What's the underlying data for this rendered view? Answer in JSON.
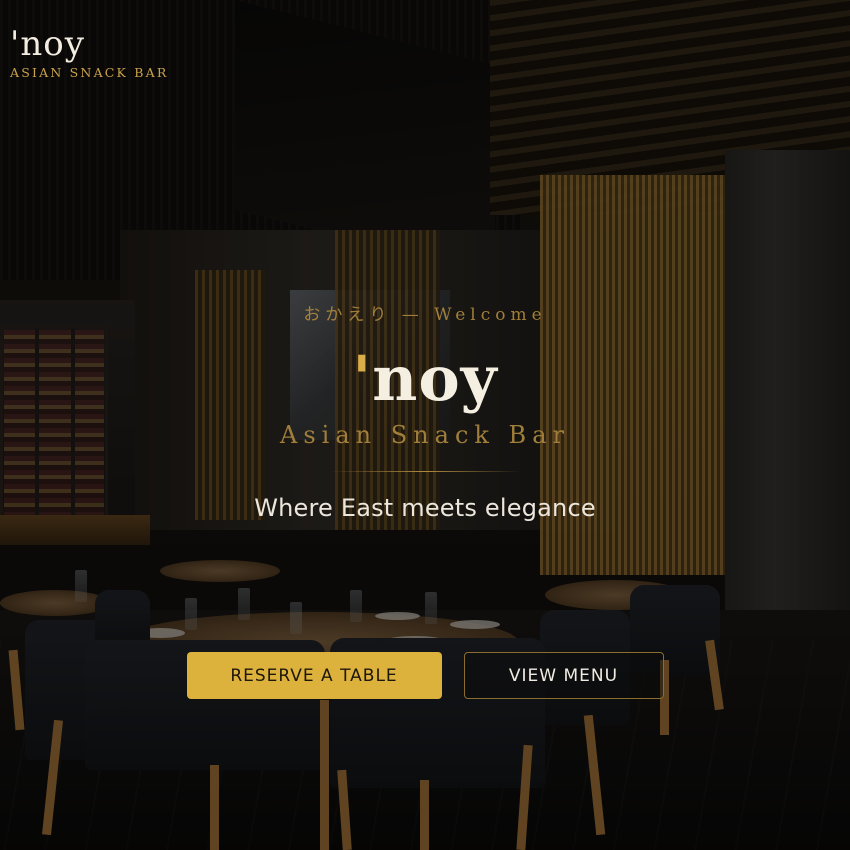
{
  "brand": {
    "name": "'noy",
    "tagline": "ASIAN SNACK BAR"
  },
  "hero": {
    "welcome": "おかえり — Welcome",
    "title_mark": "'",
    "title_text": "noy",
    "subtitle": "Asian Snack Bar",
    "tagline": "Where East meets elegance"
  },
  "actions": {
    "reserve_label": "RESERVE A TABLE",
    "menu_label": "VIEW MENU"
  },
  "colors": {
    "accent_gold": "#dcb13c",
    "text_cream": "#f5efe2",
    "muted_gold": "#a17f3b"
  }
}
